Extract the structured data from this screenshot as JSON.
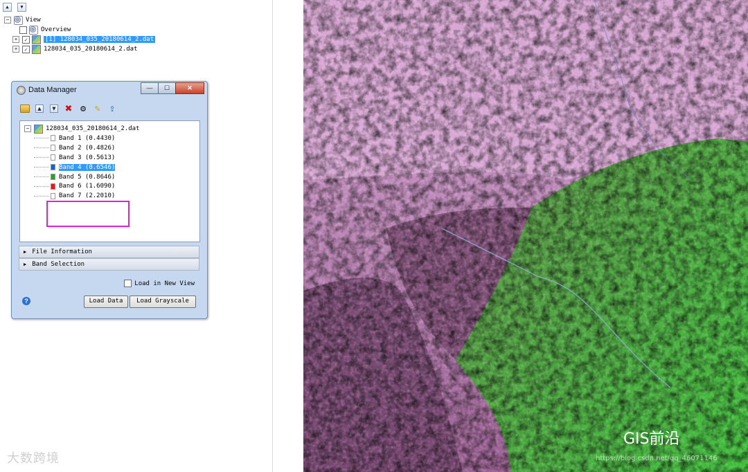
{
  "layer_manager": {
    "root": "View",
    "items": [
      {
        "label": "Overview",
        "checked": false
      },
      {
        "label": "[1] 128034_035_20180614_2.dat",
        "checked": true,
        "selected": true
      },
      {
        "label": "128034_035_20180614_2.dat",
        "checked": true,
        "selected": false
      }
    ]
  },
  "dialog": {
    "title": "Data Manager",
    "window_buttons": {
      "minimize": "—",
      "maximize": "☐",
      "close": "✕"
    },
    "toolbar_icons": [
      "open-folder-icon",
      "collapse-icon",
      "expand-icon",
      "close-file-icon",
      "save-icon",
      "pin-icon",
      "export-icon"
    ],
    "file": "128034_035_20180614_2.dat",
    "bands": [
      {
        "label": "Band 1 (0.4430)",
        "color": "#ffffff"
      },
      {
        "label": "Band 2 (0.4826)",
        "color": "#ffffff"
      },
      {
        "label": "Band 3 (0.5613)",
        "color": "#ffffff"
      },
      {
        "label": "Band 4 (0.6546)",
        "color": "#1565c0",
        "highlighted": true
      },
      {
        "label": "Band 5 (0.8646)",
        "color": "#2e9e2e"
      },
      {
        "label": "Band 6 (1.6090)",
        "color": "#d62020"
      },
      {
        "label": "Band 7 (2.2010)",
        "color": "#ffffff"
      }
    ],
    "sections": [
      "File Information",
      "Band Selection"
    ],
    "load_in_new_view": "Load in New View",
    "load_data": "Load Data",
    "load_grayscale": "Load Grayscale",
    "help": "?"
  },
  "watermarks": {
    "left": "大数跨境",
    "gis": "GIS前沿",
    "url": "https://blog.csdn.net/qq_46071146"
  },
  "colors": {
    "selection": "#3399ff",
    "highlight_box": "#e21fd6",
    "vegetation": "#3fa83a",
    "bare_soil": "#c98fc4"
  }
}
